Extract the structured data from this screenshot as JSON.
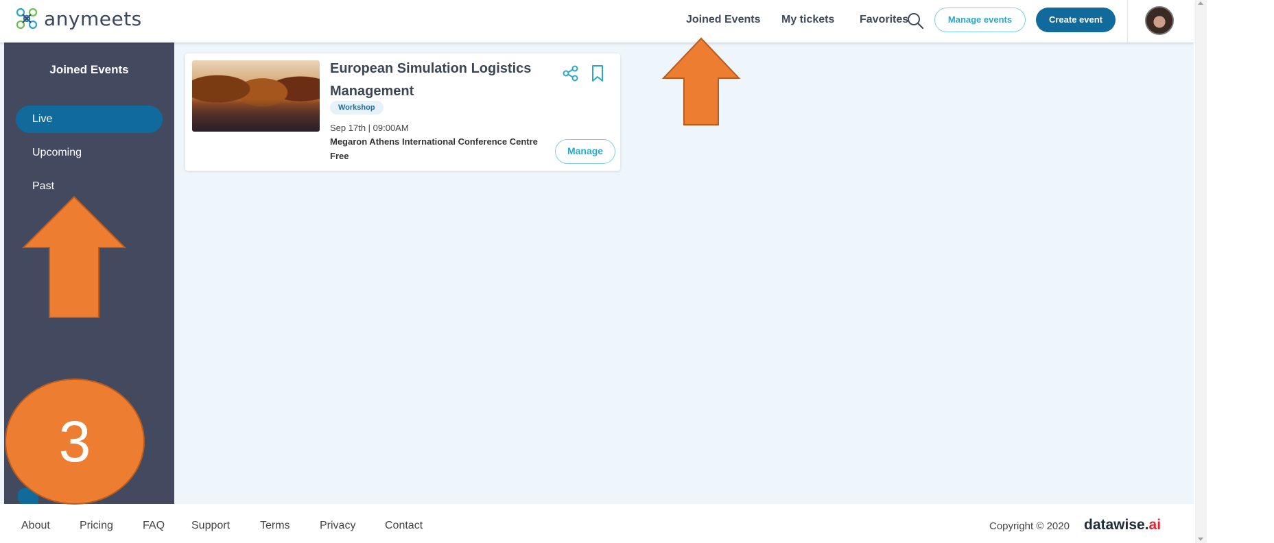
{
  "app": {
    "logo_text": "anymeets"
  },
  "header": {
    "nav": [
      "Joined Events",
      "My tickets",
      "Favorites"
    ],
    "manage_events": "Manage events",
    "create_event": "Create event",
    "icons": {
      "search": "search-icon",
      "avatar": "user-avatar"
    }
  },
  "sidebar": {
    "title": "Joined Events",
    "items": [
      {
        "label": "Live",
        "active": true
      },
      {
        "label": "Upcoming",
        "active": false
      },
      {
        "label": "Past",
        "active": false
      }
    ]
  },
  "event": {
    "title": "European Simulation Logistics Management",
    "type": "Workshop",
    "datetime": "Sep 17th | 09:00AM",
    "venue": "Megaron Athens International Conference Centre",
    "price": "Free",
    "manage_label": "Manage",
    "icons": [
      "share-icon",
      "bookmark-icon"
    ]
  },
  "annotation": {
    "step_number": "3",
    "color": "#ed7d31"
  },
  "footer": {
    "links": [
      "About",
      "Pricing",
      "FAQ",
      "Support",
      "Terms",
      "Privacy",
      "Contact"
    ],
    "copyright": "Copyright © 2020",
    "brand_main": "datawise.",
    "brand_ai": "ai"
  },
  "colors": {
    "primary": "#116a9c",
    "accent": "#2aa8c9",
    "sidebar": "#434a5f",
    "background": "#eef6fc"
  }
}
